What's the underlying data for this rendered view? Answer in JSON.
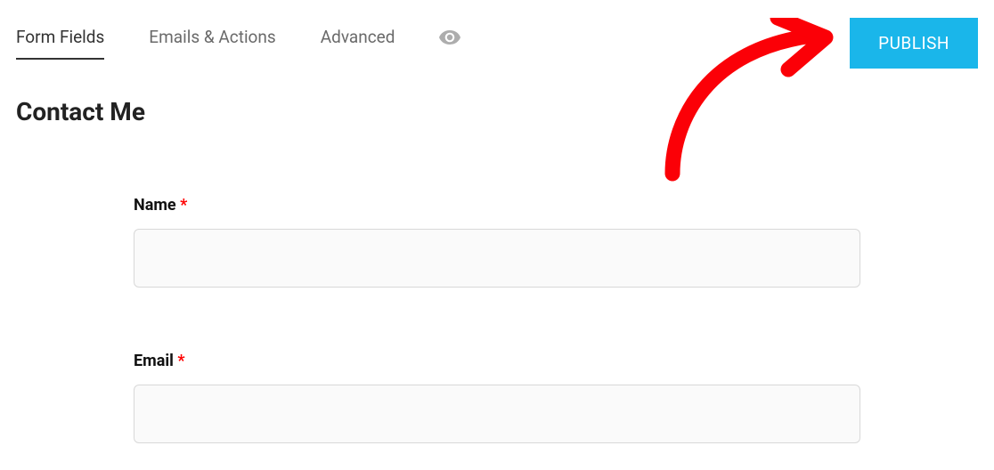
{
  "tabs": {
    "form_fields": "Form Fields",
    "emails_actions": "Emails & Actions",
    "advanced": "Advanced"
  },
  "header": {
    "publish_label": "PUBLISH"
  },
  "page": {
    "title": "Contact Me"
  },
  "form": {
    "fields": [
      {
        "label": "Name",
        "required_marker": "*",
        "value": ""
      },
      {
        "label": "Email",
        "required_marker": "*",
        "value": ""
      }
    ]
  },
  "colors": {
    "accent": "#1ab6ea",
    "required": "#ff0000",
    "annotation": "#fb0007"
  }
}
